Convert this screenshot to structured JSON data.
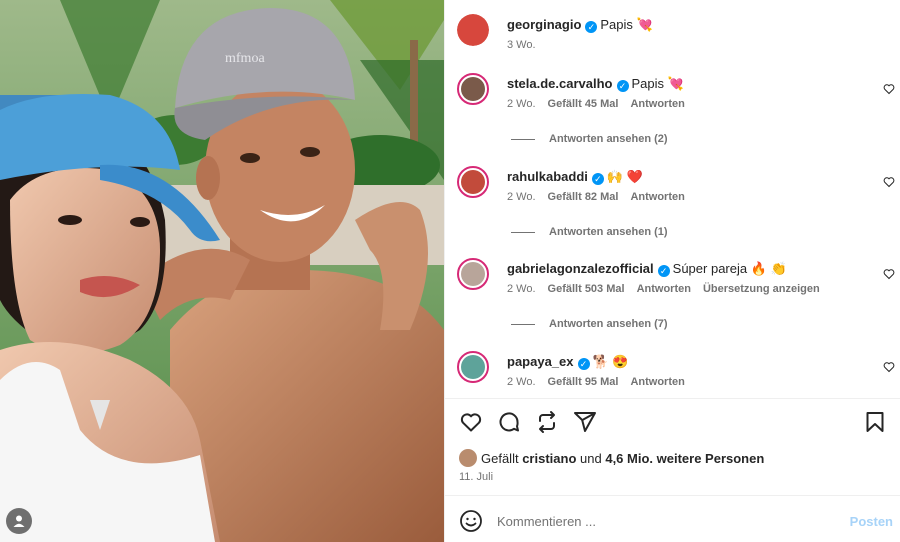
{
  "post": {
    "date": "11. Juli",
    "image_alt": "Selfie of a woman in a blue cap and a shirtless man in a grey cap by the pool",
    "cap_text": "mfmoa",
    "likes": {
      "prefix": "Gefällt",
      "user": "cristiano",
      "middle": "und",
      "count": "4,6 Mio. weitere Personen"
    }
  },
  "caption": {
    "username": "georginagio",
    "text": "Papis 💘",
    "time": "3 Wo."
  },
  "comments": [
    {
      "username": "stela.de.carvalho",
      "text": "Papis 💘",
      "time": "2 Wo.",
      "likes": "Gefällt 45 Mal",
      "reply": "Antworten",
      "view_replies": "Antworten ansehen (2)"
    },
    {
      "username": "rahulkabaddi",
      "text": "🙌 ❤️",
      "time": "2 Wo.",
      "likes": "Gefällt 82 Mal",
      "reply": "Antworten",
      "view_replies": "Antworten ansehen (1)"
    },
    {
      "username": "gabrielagonzalezofficial",
      "text": "Súper pareja 🔥 👏",
      "time": "2 Wo.",
      "likes": "Gefällt 503 Mal",
      "reply": "Antworten",
      "translate": "Übersetzung anzeigen",
      "view_replies": "Antworten ansehen (7)"
    },
    {
      "username": "papaya_ex",
      "text": "🐕 😍",
      "time": "2 Wo.",
      "likes": "Gefällt 95 Mal",
      "reply": "Antworten"
    }
  ],
  "comment_box": {
    "placeholder": "Kommentieren ...",
    "post_label": "Posten"
  },
  "colors": {
    "verified": "#0095f6",
    "story_ring": "#d62976",
    "post_disabled": "#a7d3f8",
    "heart_red": "#ed4956"
  },
  "icons": [
    "heart-icon",
    "comment-icon",
    "share-icon",
    "send-icon",
    "bookmark-icon",
    "emoji-icon",
    "verified-icon",
    "user-tag-icon"
  ]
}
